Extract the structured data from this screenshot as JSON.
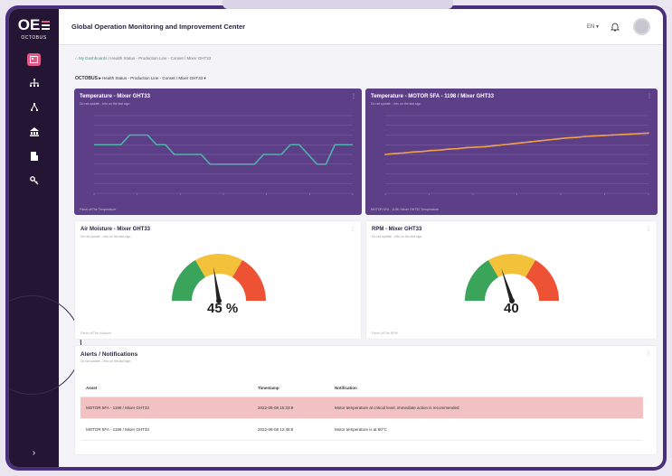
{
  "sidebar": {
    "logo_text": "OE",
    "logo_sub": "OCTOBUS",
    "nav_icons": [
      "dashboard-icon",
      "hierarchy-icon",
      "network-icon",
      "building-icon",
      "report-icon",
      "key-icon"
    ],
    "collapse_label": "›"
  },
  "header": {
    "title": "Global Operation Monitoring and Improvement Center",
    "language": "EN ▾"
  },
  "breadcrumb": {
    "home": "⌂ My Dashboards",
    "path": "/ Health Status - Production Line - Conset / Mixer GHT33"
  },
  "selector": {
    "brand": "OCTOBUS ▸",
    "path": "Health Status - Production Line - Conset / Mixer GHT33 ▾"
  },
  "cards": {
    "temp_mixer": {
      "title": "Temperature - Mixer GHT33",
      "subtitle": "Do not update - Info on the last sign",
      "footer": "Panel of/The Temperature"
    },
    "temp_motor": {
      "title": "Temperature - MOTOR 5FA - 1198 / Mixer GHT33",
      "subtitle": "Do not update - Info on the last sign",
      "footer": "MOTOR 5FA - 1198 / Mixer GHT33 Temperature"
    },
    "moisture": {
      "title": "Air Moisture - Mixer GHT33",
      "subtitle": "Do not update - Info on the last sign",
      "value": "45 %",
      "gauge_level": 0.45,
      "footer": "Panel of/The Moisture"
    },
    "rpm": {
      "title": "RPM - Mixer GHT33",
      "subtitle": "Do not update - Info on the last sign",
      "value": "40",
      "gauge_level": 0.4,
      "footer": "Panel of/The RPM"
    }
  },
  "alerts": {
    "title": "Alerts / Notifications",
    "subtitle": "Do not update - Info on the last sign",
    "columns": [
      "Asset",
      "Timestamp",
      "Notification"
    ],
    "rows": [
      {
        "asset": "MOTOR 5FA - 1198 / Mixer GHT33",
        "timestamp": "2022-08-08 15:33:9",
        "notification": "Motor temperature at critical level, immediate action is recommended",
        "critical": true
      },
      {
        "asset": "MOTOR 5FA - 1198 / Mixer GHT33",
        "timestamp": "2022-08-08 12:48:9",
        "notification": "Motor temperature is at 60°C",
        "critical": false
      }
    ]
  },
  "colors": {
    "sidebar_bg": "#241534",
    "card_purple": "#5d3f88",
    "line_teal": "#4fb3a7",
    "line_orange": "#f0a04b",
    "gauge_green": "#3aa45a",
    "gauge_yellow": "#f3c23a",
    "gauge_red": "#ee5234",
    "alert_row": "#f2c2c2"
  },
  "chart_data": [
    {
      "type": "line",
      "x": [
        1,
        2,
        3,
        4,
        5,
        6,
        7,
        8,
        9,
        10,
        11,
        12,
        13,
        14,
        15,
        16,
        17,
        18,
        19,
        20,
        21,
        22,
        23,
        24,
        25,
        26,
        27,
        28,
        29,
        30
      ],
      "series": [
        {
          "values": [
            3,
            3,
            3,
            3,
            4,
            4,
            4,
            3,
            3,
            2,
            2,
            2,
            2,
            1,
            1,
            1,
            1,
            1,
            1,
            2,
            2,
            2,
            3,
            3,
            2,
            1,
            1,
            3,
            3,
            3
          ]
        }
      ],
      "ylim": [
        -2,
        6
      ],
      "grid": true
    },
    {
      "type": "line",
      "x": [
        1,
        2,
        3,
        4,
        5,
        6,
        7,
        8,
        9,
        10,
        11,
        12,
        13,
        14,
        15,
        16,
        17,
        18,
        19,
        20,
        21,
        22,
        23,
        24,
        25,
        26,
        27,
        28,
        29,
        30
      ],
      "series": [
        {
          "values": [
            2.0,
            2.1,
            2.15,
            2.25,
            2.3,
            2.4,
            2.45,
            2.55,
            2.6,
            2.7,
            2.75,
            2.8,
            2.9,
            3.0,
            3.1,
            3.2,
            3.3,
            3.4,
            3.5,
            3.6,
            3.7,
            3.75,
            3.85,
            3.9,
            3.95,
            4.0,
            4.05,
            4.1,
            4.15,
            4.2
          ]
        }
      ],
      "ylim": [
        -2,
        6
      ],
      "grid": true
    }
  ]
}
